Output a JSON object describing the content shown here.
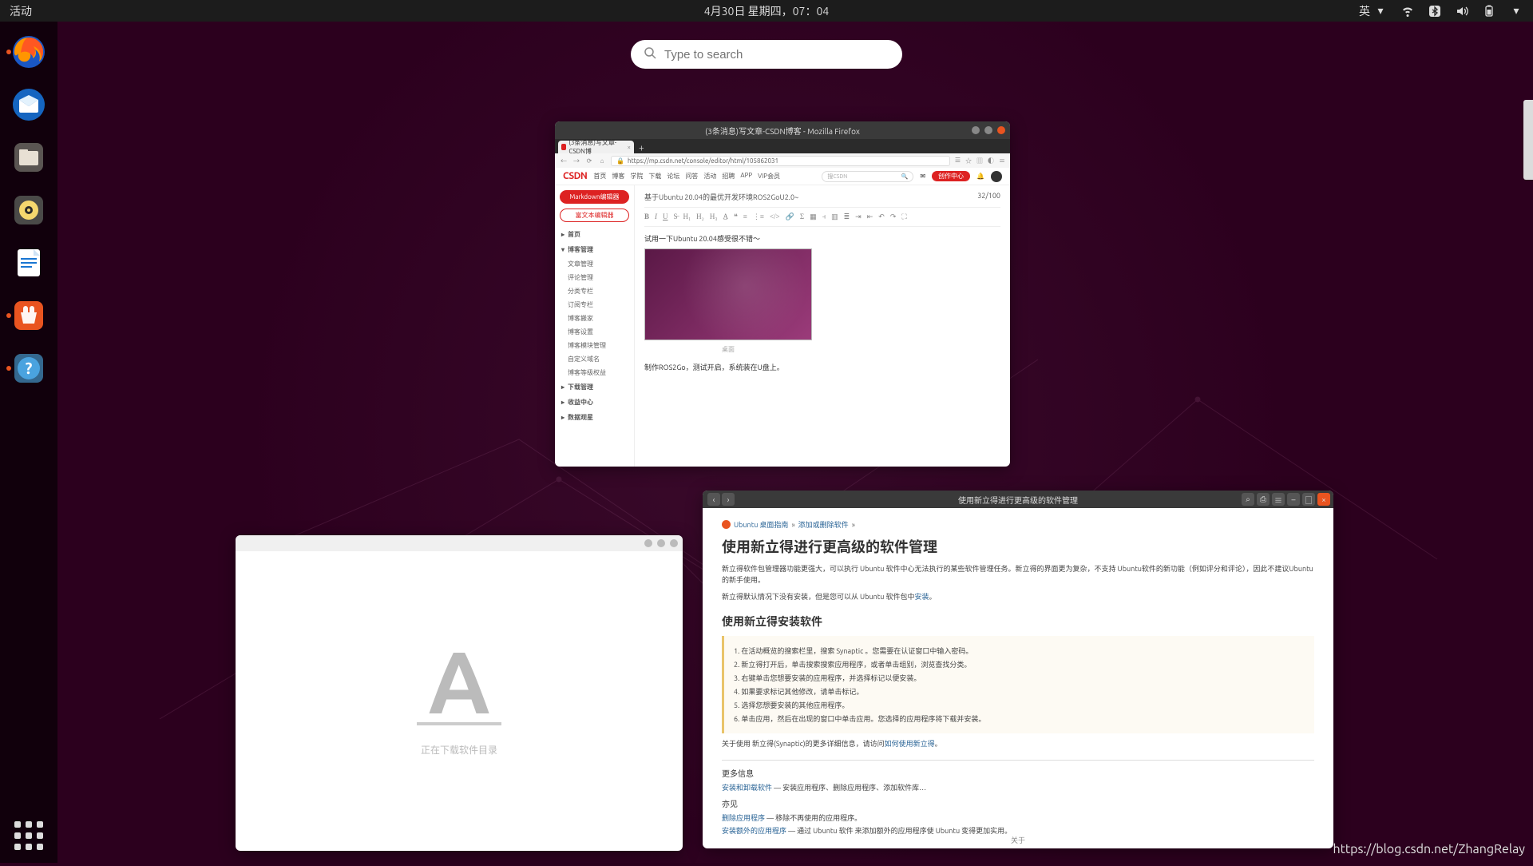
{
  "topbar": {
    "activities": "活动",
    "datetime": "4月30日 星期四，07：04",
    "ime": "英"
  },
  "search": {
    "placeholder": "Type to search"
  },
  "dock": {
    "items": [
      {
        "name": "firefox-icon"
      },
      {
        "name": "thunderbird-icon"
      },
      {
        "name": "files-icon"
      },
      {
        "name": "rhythmbox-icon"
      },
      {
        "name": "libreoffice-writer-icon"
      },
      {
        "name": "ubuntu-software-icon"
      },
      {
        "name": "help-icon"
      }
    ]
  },
  "firefox": {
    "title": "(3条消息)写文章-CSDN博客 - Mozilla Firefox",
    "tab": "(3条消息)写文章-CSDN博",
    "url": "https://mp.csdn.net/console/editor/html/105862031",
    "csdn": {
      "logo": "CSDN",
      "nav": [
        "首页",
        "博客",
        "学院",
        "下载",
        "论坛",
        "问答",
        "活动",
        "招聘",
        "APP",
        "VIP会员"
      ],
      "search_ph": "搜CSDN",
      "publish": "创作中心"
    },
    "side": {
      "btn1": "Markdown编辑器",
      "btn2": "富文本编辑器",
      "sec_home": "首页",
      "sec_mgmt": "博客管理",
      "subs": [
        "文章管理",
        "评论管理",
        "分类专栏",
        "订阅专栏",
        "博客搬家",
        "博客设置",
        "博客模块管理",
        "自定义域名",
        "博客等级权益"
      ],
      "sec_dl": "下载管理",
      "sec_ask": "收益中心",
      "sec_data": "数据观星"
    },
    "article": {
      "title": "基于Ubuntu 20.04的最优开发环境ROS2GoU2.0~",
      "counter": "32/100",
      "line1": "试用一下Ubuntu 20.04感受很不错～",
      "caption": "桌面",
      "line2": "制作ROS2Go，测试开启，系统装在U盘上。"
    }
  },
  "softcenter": {
    "loading": "正在下载软件目录"
  },
  "help": {
    "title": "使用新立得进行更高级的软件管理",
    "crumb1": "Ubuntu 桌面指南",
    "crumb2": "添加或删除软件",
    "h1": "使用新立得进行更高级的软件管理",
    "p1a": "新立得软件包管理器功能更强大，可以执行 Ubuntu 软件中心无法执行的某些软件管理任务。新立得的界面更为复杂，不支持 Ubuntu软件的新功能（例如评分和评论），因此不建议Ubuntu的新手使用。",
    "p1b_pre": "新立得默认情况下没有安装，但是您可以从 Ubuntu 软件包中",
    "p1b_link": "安装",
    "p1b_post": "。",
    "h2": "使用新立得安装软件",
    "steps": [
      "在活动概览的搜索栏里，搜索 Synaptic 。您需要在认证窗口中输入密码。",
      "新立得打开后，单击搜索搜索应用程序，或者单击组别，浏览查找分类。",
      "右键单击您想要安装的应用程序，并选择标记以便安装。",
      "如果要求标记其他修改，请单击标记。",
      "选择您想要安装的其他应用程序。",
      "单击应用，然后在出现的窗口中单击应用。您选择的应用程序将下载并安装。"
    ],
    "p_more_pre": "关于使用 新立得(Synaptic)的更多详细信息，请访问",
    "p_more_link": "如何使用新立得",
    "more_h": "更多信息",
    "more1_link": "安装和卸载软件",
    "more1_rest": " — 安装应用程序、删除应用程序、添加软件库…",
    "more2_h": "亦见",
    "more3_link": "删除应用程序",
    "more3_rest": " — 移除不再使用的应用程序。",
    "more4_link": "安装额外的应用程序",
    "more4_rest": " — 通过 Ubuntu 软件 来添加额外的应用程序使 Ubuntu 变得更加实用。",
    "about": "关于"
  },
  "watermark": "https://blog.csdn.net/ZhangRelay"
}
